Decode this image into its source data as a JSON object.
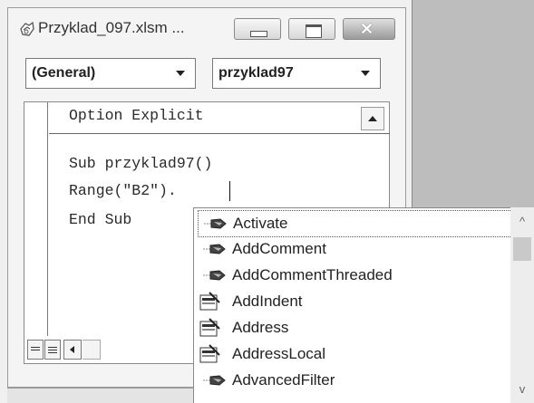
{
  "window": {
    "title": "Przyklad_097.xlsm ...",
    "icon": "vba-code-module-icon"
  },
  "window_buttons": {
    "minimize_icon": "minimize-icon",
    "maximize_icon": "maximize-icon",
    "close_glyph": "✕"
  },
  "dropdowns": {
    "object": {
      "value": "(General)"
    },
    "procedure": {
      "value": "przyklad97"
    }
  },
  "code": {
    "lines": [
      "Option Explicit",
      "Sub przyklad97()",
      "Range(\"B2\").",
      "End Sub"
    ]
  },
  "autocomplete": {
    "selected_index": 0,
    "items": [
      {
        "label": "Activate",
        "icon": "method-icon"
      },
      {
        "label": "AddComment",
        "icon": "method-icon"
      },
      {
        "label": "AddCommentThreaded",
        "icon": "method-icon"
      },
      {
        "label": "AddIndent",
        "icon": "property-icon"
      },
      {
        "label": "Address",
        "icon": "property-icon"
      },
      {
        "label": "AddressLocal",
        "icon": "property-icon"
      },
      {
        "label": "AdvancedFilter",
        "icon": "method-icon"
      }
    ],
    "scroll_up_glyph": "^",
    "scroll_down_glyph": "v"
  },
  "colors": {
    "window_bg": "#f4f4f4",
    "editor_bg": "#ffffff",
    "side_panel": "#bdbdbd"
  }
}
